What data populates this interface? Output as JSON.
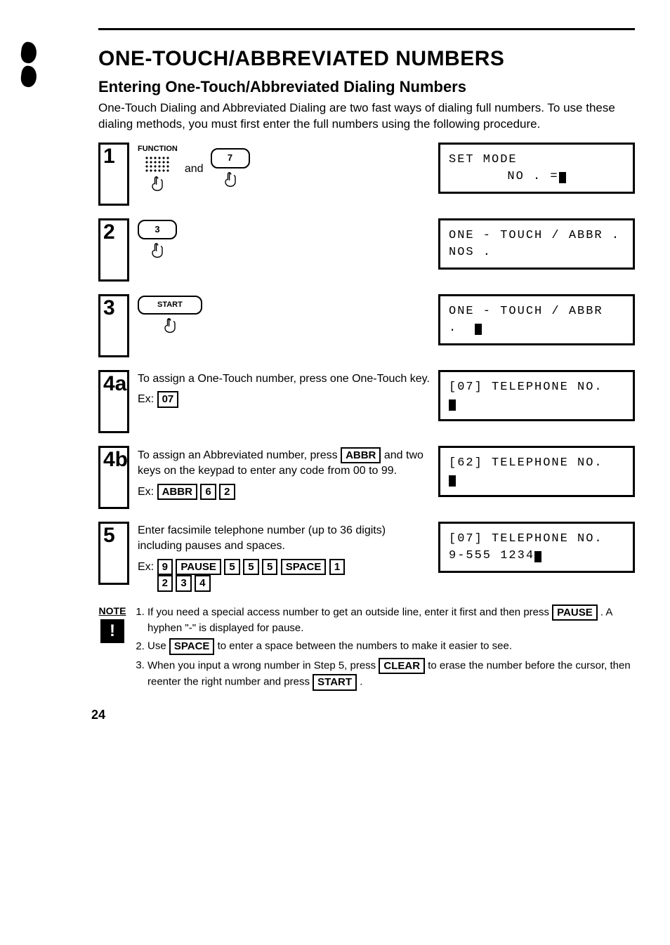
{
  "heading": "ONE-TOUCH/ABBREVIATED NUMBERS",
  "subheading": "Entering One-Touch/Abbreviated Dialing Numbers",
  "intro": "One-Touch Dialing and Abbreviated Dialing are two fast ways of dialing full numbers. To use these dialing methods, you must first enter the full numbers using the following procedure.",
  "steps": {
    "s1": {
      "num": "1",
      "func_label": "FUNCTION",
      "and": "and",
      "key": "7",
      "lcd_line1": "SET MODE",
      "lcd_line2": "NO . ="
    },
    "s2": {
      "num": "2",
      "key": "3",
      "lcd_line1": "ONE - TOUCH / ABBR . NOS ."
    },
    "s3": {
      "num": "3",
      "key": "START",
      "lcd_line1": "ONE - TOUCH / ABBR ."
    },
    "s4a": {
      "num": "4a",
      "text": "To assign a One-Touch number, press one One-Touch key.",
      "ex_prefix": "Ex:",
      "ex_key": "07",
      "lcd_line1": "[07] TELEPHONE NO."
    },
    "s4b": {
      "num": "4b",
      "text_a": "To assign an Abbreviated number, press ",
      "abbr_key": "ABBR",
      "text_b": " and two keys on the keypad to enter any code from 00 to 99.",
      "ex_prefix": "Ex:",
      "ex_k1": "ABBR",
      "ex_k2": "6",
      "ex_k3": "2",
      "lcd_line1": "[62] TELEPHONE NO."
    },
    "s5": {
      "num": "5",
      "text": "Enter facsimile telephone number (up to 36 digits) including pauses and spaces.",
      "ex_prefix": "Ex:",
      "k": [
        "9",
        "PAUSE",
        "5",
        "5",
        "5",
        "SPACE",
        "1",
        "2",
        "3",
        "4"
      ],
      "lcd_line1": "[07] TELEPHONE NO.",
      "lcd_line2": "9-555 1234"
    }
  },
  "note_label": "NOTE",
  "note_mark": "!",
  "notes": {
    "n1a": "If you need a special access number to get an outside line, enter it first and then press ",
    "n1_key": "PAUSE",
    "n1b": " . A hyphen \"-\" is displayed for pause.",
    "n2a": "Use ",
    "n2_key": "SPACE",
    "n2b": " to enter a space between the numbers to make it easier to see.",
    "n3a": "When you input a wrong number in Step 5, press ",
    "n3_key1": "CLEAR",
    "n3b": " to erase the number before the cursor, then reenter the right number and press ",
    "n3_key2": "START",
    "n3c": " ."
  },
  "page_number": "24"
}
